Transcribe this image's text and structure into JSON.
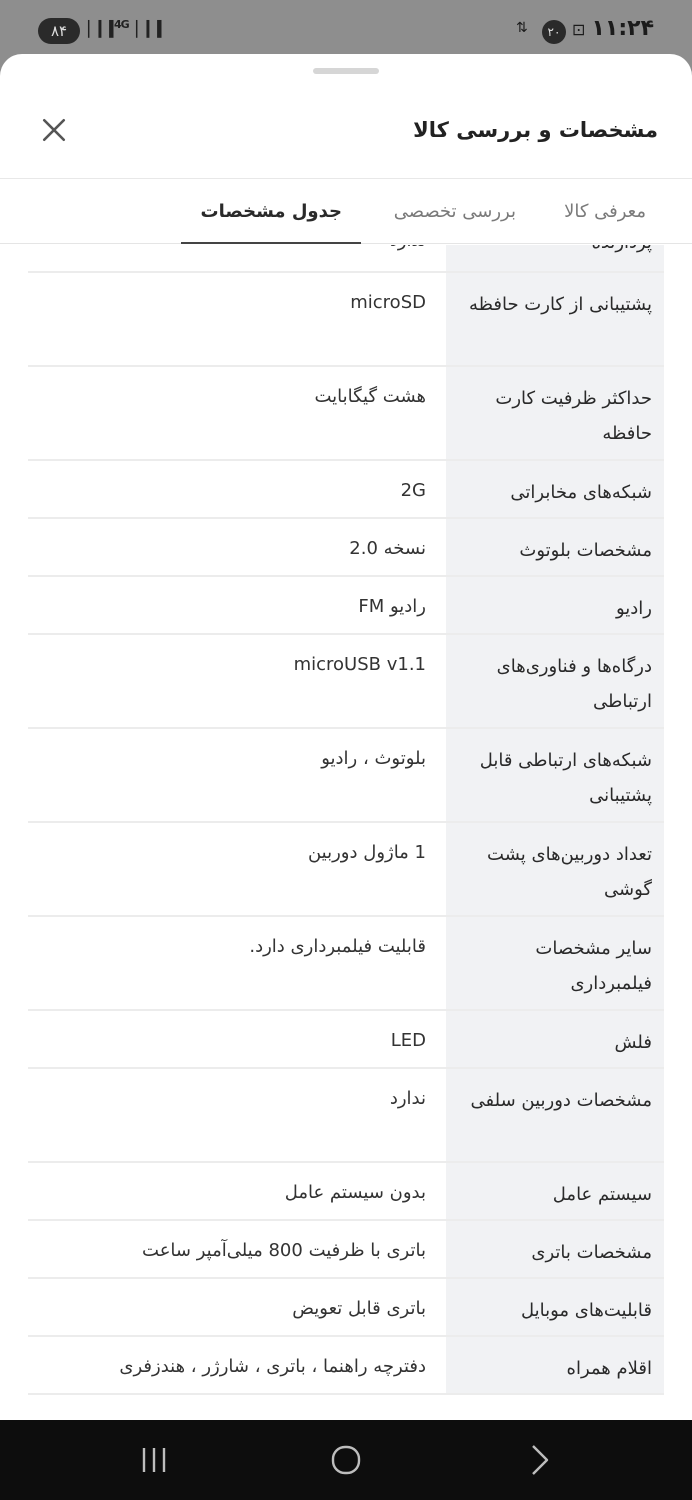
{
  "status_bar": {
    "battery": "۸۴",
    "network": "4G",
    "time": "۱۱:۲۴",
    "notification_count": "۲۰",
    "data_label": "۲۰"
  },
  "sheet": {
    "title": "مشخصات و بررسی کالا",
    "tabs": [
      {
        "label": "معرفی کالا"
      },
      {
        "label": "بررسی تخصصی"
      },
      {
        "label": "جدول مشخصات"
      }
    ]
  },
  "specs": [
    {
      "label": "پردازنده",
      "value": "ندارد"
    },
    {
      "label": "پشتیبانی از کارت حافظه",
      "value": "microSD"
    },
    {
      "label": "حداکثر ظرفیت کارت حافظه",
      "value": "هشت گیگابایت"
    },
    {
      "label": "شبکه‌های مخابراتی",
      "value": "2G"
    },
    {
      "label": "مشخصات بلوتوث",
      "value": "نسخه 2.0"
    },
    {
      "label": "رادیو",
      "value": "رادیو FM"
    },
    {
      "label": "درگاه‌ها و فناوری‌های ارتباطی",
      "value": "microUSB v1.1"
    },
    {
      "label": "شبکه‌های ارتباطی قابل پشتیبانی",
      "value": "بلوتوث ، رادیو"
    },
    {
      "label": "تعداد دوربین‌های پشت گوشی",
      "value": "1 ماژول دوربین"
    },
    {
      "label": "سایر مشخصات فیلمبرداری",
      "value": "قابلیت فیلمبرداری دارد."
    },
    {
      "label": "فلش",
      "value": "LED"
    },
    {
      "label": "مشخصات دوربین سلفی",
      "value": "ندارد"
    },
    {
      "label": "سیستم عامل",
      "value": "بدون سیستم عامل"
    },
    {
      "label": "مشخصات باتری",
      "value": "باتری با ظرفیت 800 میلی‌آمپر ساعت"
    },
    {
      "label": "قابلیت‌های موبایل",
      "value": "باتری قابل تعویض"
    },
    {
      "label": "اقلام همراه",
      "value": "دفترچه راهنما ، باتری ، شارژر ، هندزفری"
    }
  ]
}
